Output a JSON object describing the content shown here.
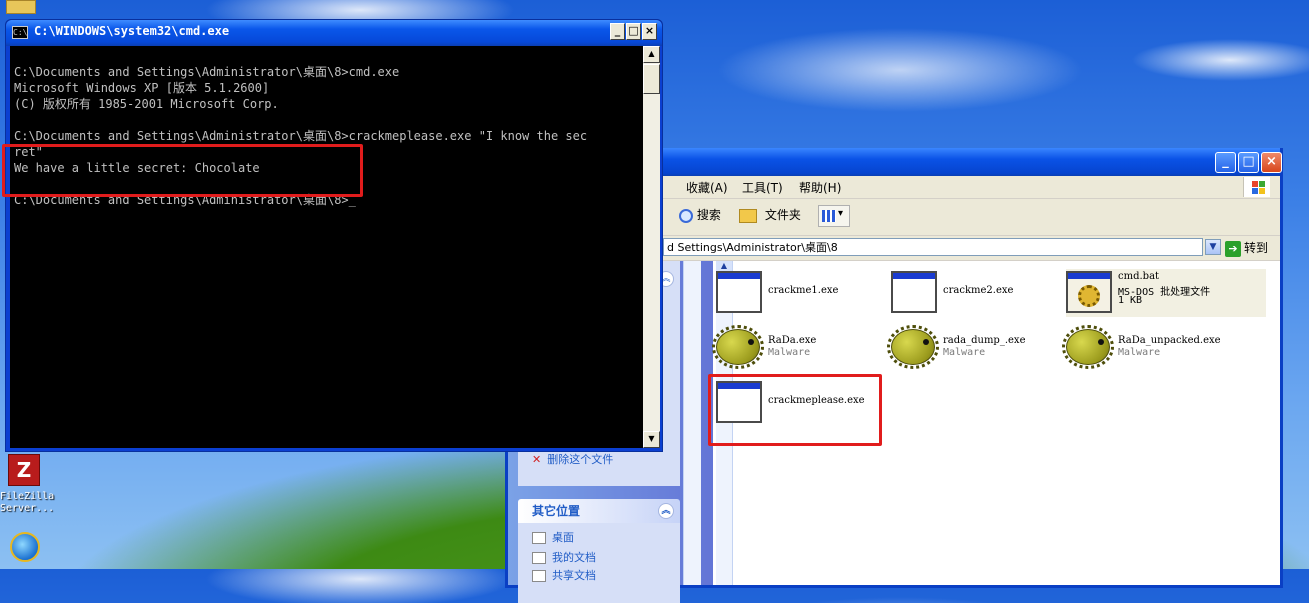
{
  "desktop": {
    "filezilla_label_1": "FileZilla",
    "filezilla_label_2": "Server..."
  },
  "cmd": {
    "title": "C:\\WINDOWS\\system32\\cmd.exe",
    "title_icon": "C:\\",
    "lines": [
      "",
      "C:\\Documents and Settings\\Administrator\\桌面\\8>cmd.exe",
      "Microsoft Windows XP [版本 5.1.2600]",
      "(C) 版权所有 1985-2001 Microsoft Corp.",
      "",
      "C:\\Documents and Settings\\Administrator\\桌面\\8>crackmeplease.exe \"I know the sec",
      "ret\"",
      "We have a little secret: Chocolate",
      "",
      "C:\\Documents and Settings\\Administrator\\桌面\\8>_"
    ],
    "buttons": {
      "minimize": "_",
      "maximize": "□",
      "close": "×"
    }
  },
  "explorer": {
    "menu": [
      "收藏(A)",
      "工具(T)",
      "帮助(H)"
    ],
    "toolbar": {
      "search": "搜索",
      "folders": "文件夹",
      "views": "▾"
    },
    "address": "d Settings\\Administrator\\桌面\\8",
    "go_label": "转到",
    "other_places": {
      "header": "其它位置",
      "items": [
        "桌面",
        "我的文档",
        "共享文档"
      ]
    },
    "hidden_task_label": "删除这个文件",
    "files": [
      {
        "name": "crackme1.exe",
        "sub": "",
        "icon": "window-app-icon"
      },
      {
        "name": "crackme2.exe",
        "sub": "",
        "icon": "window-app-icon"
      },
      {
        "name": "cmd.bat",
        "sub": "MS-DOS 批处理文件",
        "sub2": "1 KB",
        "icon": "batch-file-icon"
      },
      {
        "name": "RaDa.exe",
        "sub": "Malware",
        "icon": "pufferfish-icon"
      },
      {
        "name": "rada_dump_.exe",
        "sub": "Malware",
        "icon": "pufferfish-icon"
      },
      {
        "name": "RaDa_unpacked.exe",
        "sub": "Malware",
        "icon": "pufferfish-icon"
      },
      {
        "name": "crackmeplease.exe",
        "sub": "",
        "icon": "window-app-icon"
      }
    ]
  },
  "colors": {
    "highlight": "#e11c1c",
    "xp_blue": "#0a52e6",
    "terminal_text": "#c0c0c0"
  }
}
